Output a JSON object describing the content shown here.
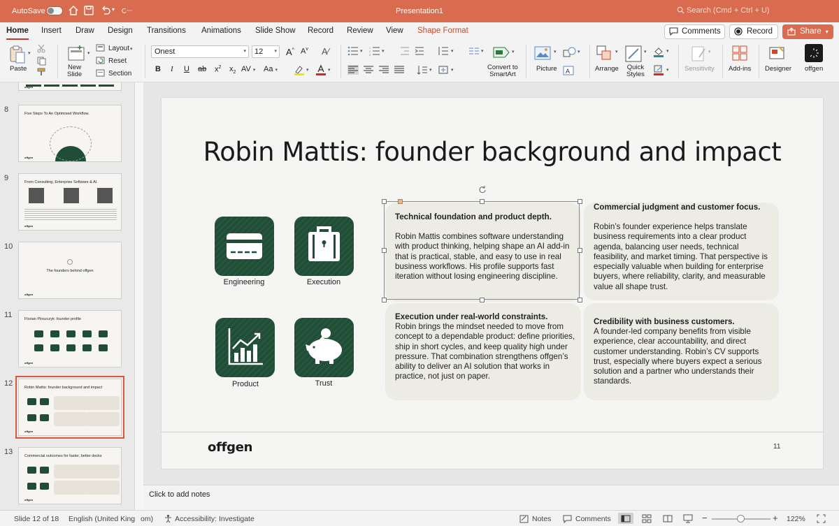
{
  "titlebar": {
    "autosave_label": "AutoSave",
    "doc_title": "Presentation1",
    "search_placeholder": "Search (Cmd + Ctrl + U)"
  },
  "tabs": [
    "Home",
    "Insert",
    "Draw",
    "Design",
    "Transitions",
    "Animations",
    "Slide Show",
    "Record",
    "Review",
    "View",
    "Shape Format"
  ],
  "top_buttons": {
    "comments": "Comments",
    "record": "Record",
    "share": "Share"
  },
  "ribbon": {
    "paste": "Paste",
    "new_slide": "New\nSlide",
    "layout": "Layout",
    "reset": "Reset",
    "section": "Section",
    "font_name": "Onest",
    "font_size": "12",
    "convert_smartart": "Convert to\nSmartArt",
    "picture": "Picture",
    "arrange": "Arrange",
    "quick_styles": "Quick\nStyles",
    "sensitivity": "Sensitivity",
    "add_ins": "Add-ins",
    "designer": "Designer",
    "offgen": "offgen"
  },
  "thumbnails": [
    {
      "num": "8",
      "title": "Five Steps To An Optimised Workflow."
    },
    {
      "num": "9",
      "title": "From Consulting, Enterprise Software & AI."
    },
    {
      "num": "10",
      "title": "The founders behind offgen"
    },
    {
      "num": "11",
      "title": "Florian Ploszczyk: founder profile"
    },
    {
      "num": "12",
      "title": "Robin Mattis: founder background and impact"
    },
    {
      "num": "13",
      "title": "Commercial outcomes for faster, better decks"
    }
  ],
  "slide": {
    "title": "Robin Mattis: founder background and impact",
    "icons": [
      {
        "label": "Engineering",
        "icon": "credit-card-icon"
      },
      {
        "label": "Execution",
        "icon": "briefcase-icon"
      },
      {
        "label": "Product",
        "icon": "bar-chart-icon"
      },
      {
        "label": "Trust",
        "icon": "piggy-bank-icon"
      }
    ],
    "cards": [
      {
        "title": "Technical foundation and product depth.",
        "body": "Robin Mattis combines software understanding with product thinking, helping shape an AI add-in that is practical, stable, and easy to use in real business workflows. His profile supports fast iteration without losing engineering discipline."
      },
      {
        "title": "Commercial judgment and customer focus.",
        "body": "Robin’s founder experience helps translate business requirements into a clear product agenda, balancing user needs, technical feasibility, and market timing. That perspective is especially valuable when building for enterprise buyers, where reliability, clarity, and measurable value all shape trust."
      },
      {
        "title": "Execution under real-world constraints.",
        "body": "Robin brings the mindset needed to move from concept to a dependable product: define priorities, ship in short cycles, and keep quality high under pressure. That combination strengthens offgen’s ability to deliver an AI solution that works in practice, not just on paper."
      },
      {
        "title": "Credibility with business customers.",
        "body": "A founder-led company benefits from visible experience, clear accountability, and direct customer understanding. Robin’s CV supports trust, especially where buyers expect a serious solution and a partner who understands their standards."
      }
    ],
    "logo": "offgen",
    "page_number": "11"
  },
  "notes_placeholder": "Click to add notes",
  "status": {
    "slide_of": "Slide 12 of 18",
    "language": "English (United King",
    "language_tail": "om)",
    "accessibility": "Accessibility: Investigate",
    "notes": "Notes",
    "comments": "Comments",
    "zoom": "122%"
  },
  "colors": {
    "accent": "#d96c4f",
    "tile_green": "#1f4d36",
    "card_bg": "#ecebe4",
    "selection": "#d9583a"
  }
}
